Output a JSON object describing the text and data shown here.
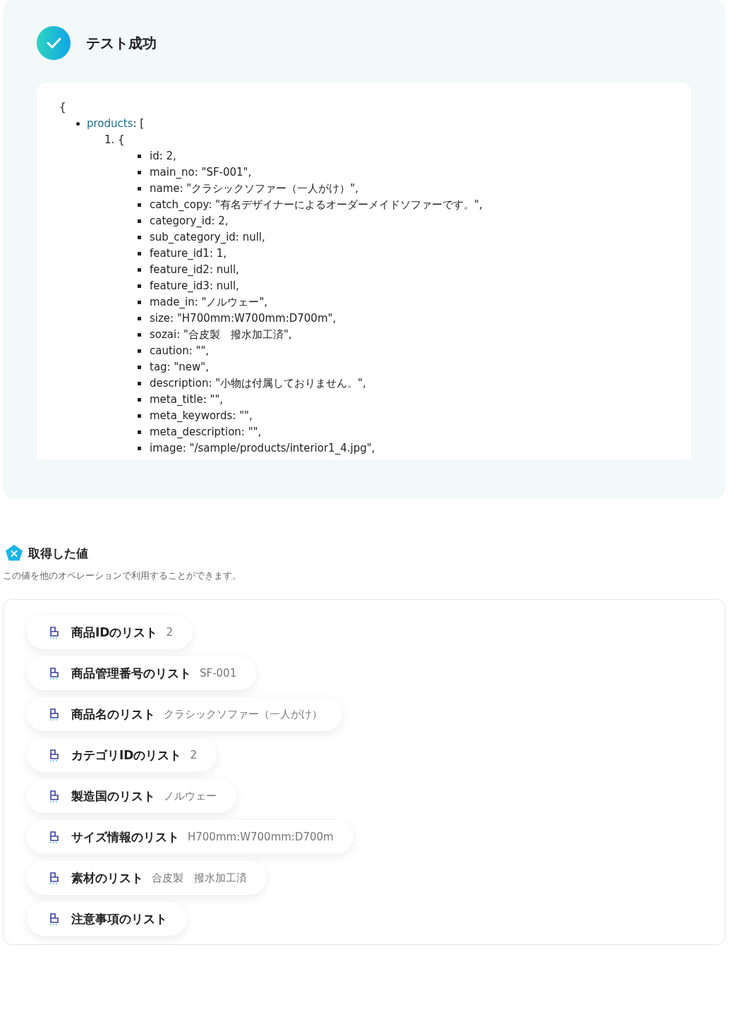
{
  "result": {
    "title": "テスト成功"
  },
  "json_viewer": {
    "opening": "{",
    "root_key": "products",
    "root_suffix": ": [",
    "item_marker": "1. {",
    "fields": [
      "id: 2,",
      "main_no: \"SF-001\",",
      "name: \"クラシックソファー（一人がけ）\",",
      "catch_copy: \"有名デザイナーによるオーダーメイドソファーです。\",",
      "category_id: 2,",
      "sub_category_id: null,",
      "feature_id1: 1,",
      "feature_id2: null,",
      "feature_id3: null,",
      "made_in: \"ノルウェー\",",
      "size: \"H700mm:W700mm:D700m\",",
      "sozai: \"合皮製　撥水加工済\",",
      "caution: \"\",",
      "tag: \"new\",",
      "description: \"小物は付属しておりません。\",",
      "meta_title: \"\",",
      "meta_keywords: \"\",",
      "meta_description: \"\",",
      "image: \"/sample/products/interior1_4.jpg\","
    ]
  },
  "acquired": {
    "title": "取得した値",
    "subtitle": "この値を他のオペレーションで利用することができます。",
    "values": [
      {
        "label": "商品IDのリスト",
        "value": "2"
      },
      {
        "label": "商品管理番号のリスト",
        "value": "SF-001"
      },
      {
        "label": "商品名のリスト",
        "value": "クラシックソファー（一人がけ）"
      },
      {
        "label": "カテゴリIDのリスト",
        "value": "2"
      },
      {
        "label": "製造国のリスト",
        "value": "ノルウェー"
      },
      {
        "label": "サイズ情報のリスト",
        "value": "H700mm:W700mm:D700m"
      },
      {
        "label": "素材のリスト",
        "value": "合皮製　撥水加工済"
      },
      {
        "label": "注意事項のリスト"
      }
    ]
  }
}
